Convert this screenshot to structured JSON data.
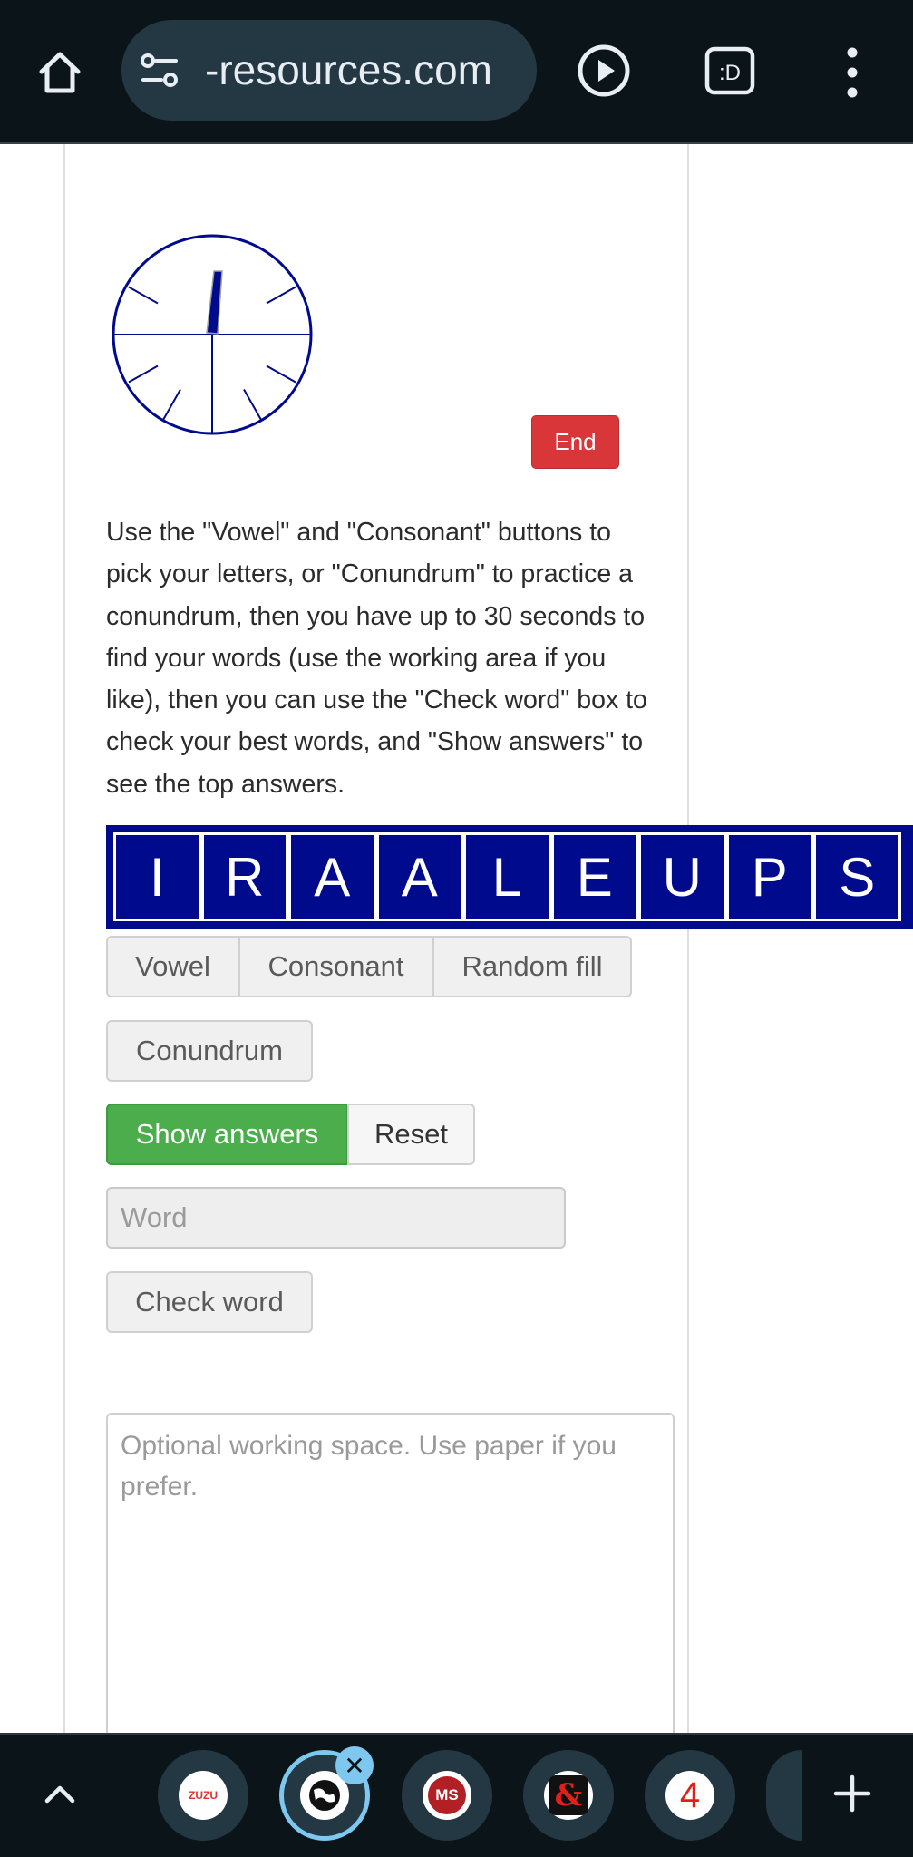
{
  "browser": {
    "url_text": "-resources.com",
    "icons": [
      "home-icon",
      "site-settings-icon",
      "play-icon",
      "tab-switcher-icon",
      "overflow-menu-icon"
    ],
    "tab_switcher_label": ":D"
  },
  "game": {
    "end_label": "End",
    "instructions": "Use the \"Vowel\" and \"Consonant\" buttons to pick your letters, or \"Conundrum\" to practice a conundrum, then you have up to 30 seconds to find your words (use the working area if you like), then you can use the \"Check word\" box to check your best words, and \"Show answers\" to see the top answers.",
    "letters": [
      "I",
      "R",
      "A",
      "A",
      "L",
      "E",
      "U",
      "P",
      "S"
    ],
    "buttons": {
      "vowel": "Vowel",
      "consonant": "Consonant",
      "random_fill": "Random fill",
      "conundrum": "Conundrum",
      "show_answers": "Show answers",
      "reset": "Reset",
      "check_word": "Check word"
    },
    "word_placeholder": "Word",
    "working_placeholder": "Optional working space. Use paper if you prefer.",
    "colors": {
      "tile_blue": "#000a8c",
      "end_red": "#d9363a",
      "show_green": "#4cad4c"
    }
  },
  "bottom_tabs": {
    "items": [
      {
        "name": "zuzu",
        "label": "ZUZU"
      },
      {
        "name": "globe",
        "label": ""
      },
      {
        "name": "ms",
        "label": "MS"
      },
      {
        "name": "ampersand",
        "label": "&"
      },
      {
        "name": "four",
        "label": "4"
      }
    ],
    "close_label": "✕"
  }
}
